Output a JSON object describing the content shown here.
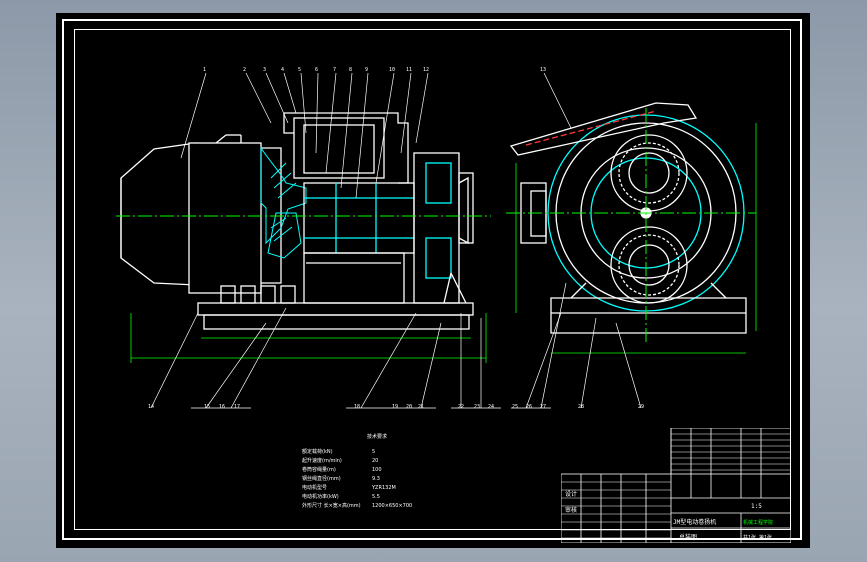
{
  "drawing": {
    "notes_title": "技术要求",
    "notes": [
      {
        "label": "额定载荷(kN)",
        "value": "5"
      },
      {
        "label": "起升速度(m/min)",
        "value": "20"
      },
      {
        "label": "卷筒容绳量(m)",
        "value": "100"
      },
      {
        "label": "钢丝绳直径(mm)",
        "value": "9.3"
      },
      {
        "label": "电动机型号",
        "value": "YZR132M"
      },
      {
        "label": "电动机功率(kW)",
        "value": "5.5"
      },
      {
        "label": "外形尺寸 长×宽×高(mm)",
        "value": "1200×650×700"
      }
    ],
    "title_block": {
      "drawing_name": "JM型电动卷扬机",
      "drawing_no": "总装图",
      "designer": "设计",
      "checker": "审核",
      "scale": "1:5",
      "sheet": "共1张 第1张",
      "school": "机械工程学院"
    }
  },
  "colors": {
    "background": "#000000",
    "primary_lines": "#ffffff",
    "centerline": "#00ff00",
    "dimension": "#00ff00",
    "hatch": "#00ffff",
    "accent": "#ff3b3b"
  }
}
